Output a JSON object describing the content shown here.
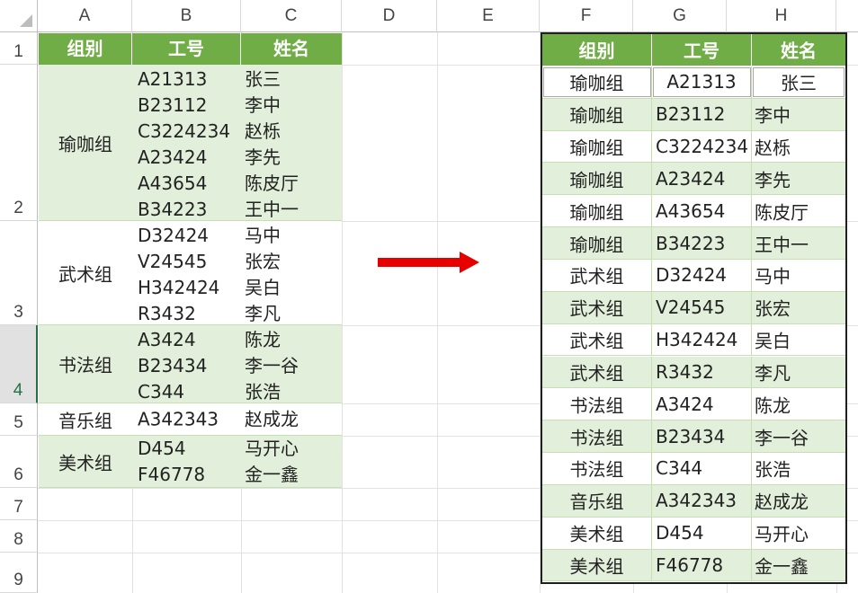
{
  "columns": [
    "A",
    "B",
    "C",
    "D",
    "E",
    "F",
    "G",
    "H"
  ],
  "rows": [
    "1",
    "2",
    "3",
    "4",
    "5",
    "6",
    "7",
    "8",
    "9"
  ],
  "colors": {
    "header_green": "#70ad47",
    "band_green": "#e2efda",
    "arrow_red": "#e60000",
    "selection_green": "#217346"
  },
  "left_table": {
    "headers": [
      "组别",
      "工号",
      "姓名"
    ],
    "groups": [
      {
        "group": "瑜咖组",
        "ids": [
          "A21313",
          "B23112",
          "C3224234",
          "A23424",
          "A43654",
          "B34223"
        ],
        "names": [
          "张三",
          "李中",
          "赵栎",
          "李先",
          "陈皮厅",
          "王中一"
        ]
      },
      {
        "group": "武术组",
        "ids": [
          "D32424",
          "V24545",
          "H342424",
          "R3432"
        ],
        "names": [
          "马中",
          "张宏",
          "吴白",
          "李凡"
        ]
      },
      {
        "group": "书法组",
        "ids": [
          "A3424",
          "B23434",
          "C344"
        ],
        "names": [
          "陈龙",
          "李一谷",
          "张浩"
        ]
      },
      {
        "group": "音乐组",
        "ids": [
          "A342343"
        ],
        "names": [
          "赵成龙"
        ]
      },
      {
        "group": "美术组",
        "ids": [
          "D454",
          "F46778"
        ],
        "names": [
          "马开心",
          "金一鑫"
        ]
      }
    ]
  },
  "arrow_icon": "right-arrow-icon",
  "right_table": {
    "headers": [
      "组别",
      "工号",
      "姓名"
    ],
    "rows": [
      [
        "瑜咖组",
        "A21313",
        "张三"
      ],
      [
        "瑜咖组",
        "B23112",
        "李中"
      ],
      [
        "瑜咖组",
        "C3224234",
        "赵栎"
      ],
      [
        "瑜咖组",
        "A23424",
        "李先"
      ],
      [
        "瑜咖组",
        "A43654",
        "陈皮厅"
      ],
      [
        "瑜咖组",
        "B34223",
        "王中一"
      ],
      [
        "武术组",
        "D32424",
        "马中"
      ],
      [
        "武术组",
        "V24545",
        "张宏"
      ],
      [
        "武术组",
        "H342424",
        "吴白"
      ],
      [
        "武术组",
        "R3432",
        "李凡"
      ],
      [
        "书法组",
        "A3424",
        "陈龙"
      ],
      [
        "书法组",
        "B23434",
        "李一谷"
      ],
      [
        "书法组",
        "C344",
        "张浩"
      ],
      [
        "音乐组",
        "A342343",
        "赵成龙"
      ],
      [
        "美术组",
        "D454",
        "马开心"
      ],
      [
        "美术组",
        "F46778",
        "金一鑫"
      ]
    ]
  }
}
